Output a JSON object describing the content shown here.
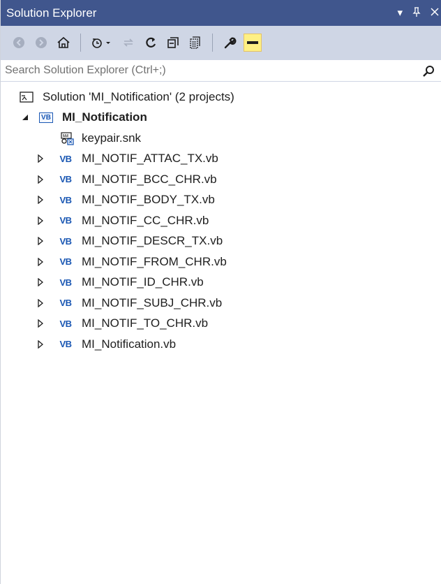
{
  "window": {
    "title": "Solution Explorer",
    "controls": {
      "dropdown": "▾",
      "pin": "ᵖ",
      "close": "✕"
    }
  },
  "search": {
    "placeholder": "Search Solution Explorer (Ctrl+;)"
  },
  "colors": {
    "titlebar": "#40568d",
    "toolbar": "#cfd6e5",
    "active_toggle": "#fef084",
    "vb_blue": "#1a57b3"
  },
  "tree": {
    "solution": "Solution 'MI_Notification' (2 projects)",
    "project": "MI_Notification",
    "project_badge": "VB",
    "keypair": "keypair.snk",
    "file_badge": "VB",
    "files": [
      "MI_NOTIF_ATTAC_TX.vb",
      "MI_NOTIF_BCC_CHR.vb",
      "MI_NOTIF_BODY_TX.vb",
      "MI_NOTIF_CC_CHR.vb",
      "MI_NOTIF_DESCR_TX.vb",
      "MI_NOTIF_FROM_CHR.vb",
      "MI_NOTIF_ID_CHR.vb",
      "MI_NOTIF_SUBJ_CHR.vb",
      "MI_NOTIF_TO_CHR.vb",
      "MI_Notification.vb"
    ]
  }
}
